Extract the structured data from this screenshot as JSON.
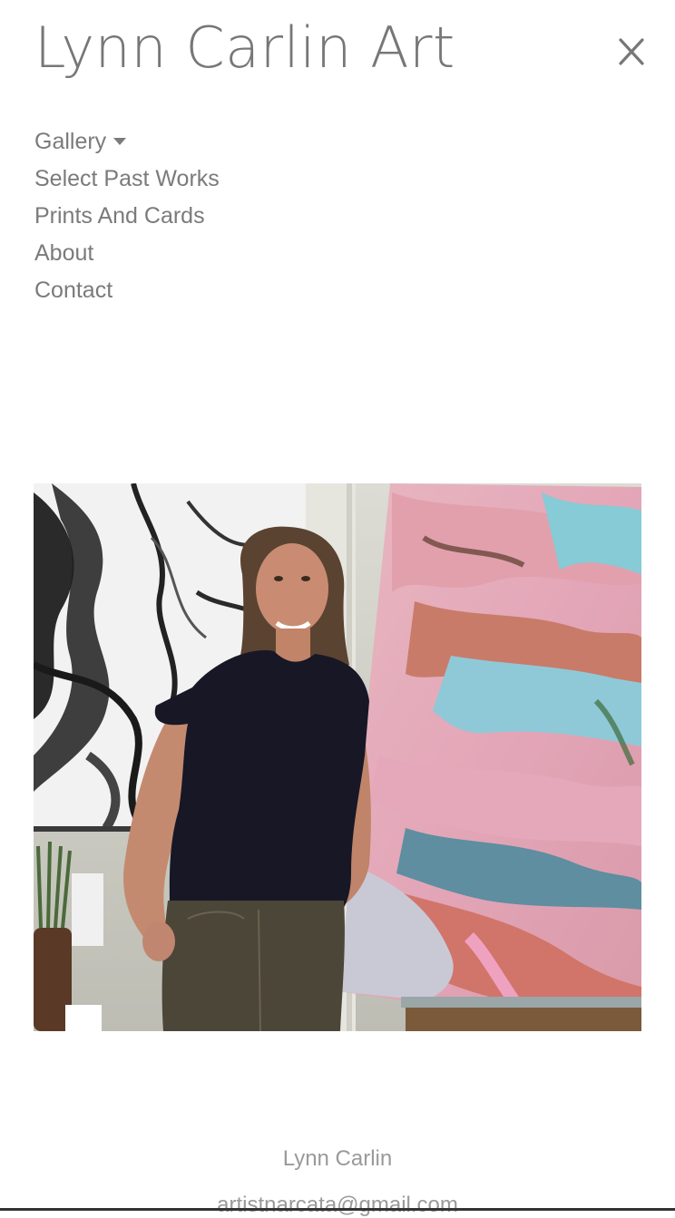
{
  "site": {
    "title": "Lynn Carlin Art"
  },
  "close_button": {
    "icon": "close-icon",
    "color": "#777777"
  },
  "nav": {
    "items": [
      {
        "label": "Gallery",
        "has_dropdown": true,
        "icon": "caret-down-icon"
      },
      {
        "label": "Select Past Works"
      },
      {
        "label": "Prints And Cards"
      },
      {
        "label": "About"
      },
      {
        "label": "Contact"
      }
    ]
  },
  "hero_photo": {
    "description_hidden": "",
    "palette": {
      "wall": "#d8d8d0",
      "shirt": "#1a1a2a",
      "pants": "#4a4436",
      "skin": "#c88a70",
      "hair": "#5a4030",
      "pink": "#e6a8b8",
      "cyan": "#7ec8d8",
      "black_white_painting_bg": "#f0f0f0"
    }
  },
  "footer": {
    "name": "Lynn Carlin",
    "email": "artistnarcata@gmail.com"
  }
}
